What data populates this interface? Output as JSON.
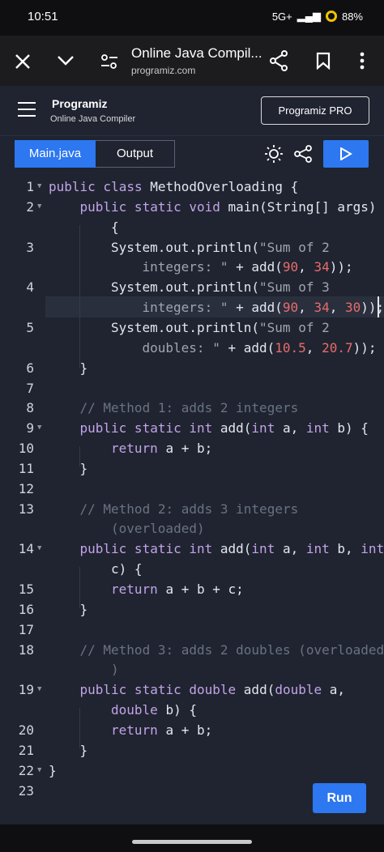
{
  "status_bar": {
    "time": "10:51",
    "network": "5G+",
    "battery": "88%"
  },
  "browser": {
    "title": "Online Java Compil...",
    "url": "programiz.com"
  },
  "header": {
    "logo": "Programiz",
    "subtitle": "Online Java Compiler",
    "pro_button": "Programiz PRO"
  },
  "tabs": {
    "main": "Main.java",
    "output": "Output"
  },
  "run_button": "Run",
  "colors": {
    "accent": "#2d77f0",
    "background": "#1f2430",
    "keyword": "#c3a3e8",
    "number": "#e86c6c",
    "comment": "#6a7282"
  },
  "code_lines": [
    {
      "num": "1",
      "fold": true,
      "segments": [
        [
          "kw",
          "public class "
        ],
        [
          "plain",
          "MethodOverloading {"
        ]
      ]
    },
    {
      "num": "2",
      "fold": true,
      "indent": 1,
      "segments": [
        [
          "kw",
          "public static void "
        ],
        [
          "plain",
          "main(String[] args)"
        ]
      ]
    },
    {
      "num": "",
      "indent": 2,
      "segments": [
        [
          "plain",
          "{"
        ]
      ]
    },
    {
      "num": "3",
      "indent": 2,
      "segments": [
        [
          "plain",
          "System.out.println("
        ],
        [
          "str",
          "\"Sum of 2"
        ]
      ]
    },
    {
      "num": "",
      "indent": 3,
      "segments": [
        [
          "str",
          "integers: \""
        ],
        [
          "plain",
          " + add("
        ],
        [
          "num",
          "90"
        ],
        [
          "plain",
          ", "
        ],
        [
          "num",
          "34"
        ],
        [
          "plain",
          "));"
        ]
      ]
    },
    {
      "num": "4",
      "indent": 2,
      "segments": [
        [
          "plain",
          "System.out.println("
        ],
        [
          "str",
          "\"Sum of 3"
        ]
      ]
    },
    {
      "num": "",
      "indent": 3,
      "segments": [
        [
          "str",
          "integers: \""
        ],
        [
          "plain",
          " + add("
        ],
        [
          "num",
          "90"
        ],
        [
          "plain",
          ", "
        ],
        [
          "num",
          "34"
        ],
        [
          "plain",
          ", "
        ],
        [
          "num",
          "30"
        ],
        [
          "plain",
          "));"
        ]
      ]
    },
    {
      "num": "5",
      "indent": 2,
      "segments": [
        [
          "plain",
          "System.out.println("
        ],
        [
          "str",
          "\"Sum of 2"
        ]
      ]
    },
    {
      "num": "",
      "indent": 3,
      "segments": [
        [
          "str",
          "doubles: \""
        ],
        [
          "plain",
          " + add("
        ],
        [
          "num",
          "10.5"
        ],
        [
          "plain",
          ", "
        ],
        [
          "num",
          "20.7"
        ],
        [
          "plain",
          "));"
        ]
      ]
    },
    {
      "num": "6",
      "indent": 1,
      "segments": [
        [
          "plain",
          "}"
        ]
      ]
    },
    {
      "num": "7",
      "segments": []
    },
    {
      "num": "8",
      "indent": 1,
      "segments": [
        [
          "cm",
          "// Method 1: adds 2 integers"
        ]
      ]
    },
    {
      "num": "9",
      "fold": true,
      "indent": 1,
      "segments": [
        [
          "kw",
          "public static int "
        ],
        [
          "plain",
          "add("
        ],
        [
          "kw",
          "int "
        ],
        [
          "plain",
          "a, "
        ],
        [
          "kw",
          "int "
        ],
        [
          "plain",
          "b) {"
        ]
      ]
    },
    {
      "num": "10",
      "indent": 2,
      "segments": [
        [
          "kw",
          "return "
        ],
        [
          "plain",
          "a + b;"
        ]
      ]
    },
    {
      "num": "11",
      "indent": 1,
      "segments": [
        [
          "plain",
          "}"
        ]
      ]
    },
    {
      "num": "12",
      "segments": []
    },
    {
      "num": "13",
      "indent": 1,
      "segments": [
        [
          "cm",
          "// Method 2: adds 3 integers"
        ]
      ]
    },
    {
      "num": "",
      "indent": 2,
      "segments": [
        [
          "cm",
          "(overloaded)"
        ]
      ]
    },
    {
      "num": "14",
      "fold": true,
      "indent": 1,
      "segments": [
        [
          "kw",
          "public static int "
        ],
        [
          "plain",
          "add("
        ],
        [
          "kw",
          "int "
        ],
        [
          "plain",
          "a, "
        ],
        [
          "kw",
          "int "
        ],
        [
          "plain",
          "b, "
        ],
        [
          "kw",
          "int"
        ]
      ]
    },
    {
      "num": "",
      "indent": 2,
      "segments": [
        [
          "plain",
          "c) {"
        ]
      ]
    },
    {
      "num": "15",
      "indent": 2,
      "segments": [
        [
          "kw",
          "return "
        ],
        [
          "plain",
          "a + b + c;"
        ]
      ]
    },
    {
      "num": "16",
      "indent": 1,
      "segments": [
        [
          "plain",
          "}"
        ]
      ]
    },
    {
      "num": "17",
      "segments": []
    },
    {
      "num": "18",
      "indent": 1,
      "segments": [
        [
          "cm",
          "// Method 3: adds 2 doubles (overloaded"
        ]
      ]
    },
    {
      "num": "",
      "indent": 2,
      "segments": [
        [
          "cm",
          ")"
        ]
      ]
    },
    {
      "num": "19",
      "fold": true,
      "indent": 1,
      "segments": [
        [
          "kw",
          "public static double "
        ],
        [
          "plain",
          "add("
        ],
        [
          "kw",
          "double "
        ],
        [
          "plain",
          "a,"
        ]
      ]
    },
    {
      "num": "",
      "indent": 2,
      "segments": [
        [
          "kw",
          "double "
        ],
        [
          "plain",
          "b) {"
        ]
      ]
    },
    {
      "num": "20",
      "indent": 2,
      "segments": [
        [
          "kw",
          "return "
        ],
        [
          "plain",
          "a + b;"
        ]
      ]
    },
    {
      "num": "21",
      "indent": 1,
      "segments": [
        [
          "plain",
          "}"
        ]
      ]
    },
    {
      "num": "22",
      "fold": true,
      "segments": [
        [
          "plain",
          "}"
        ]
      ]
    },
    {
      "num": "23",
      "segments": []
    }
  ]
}
